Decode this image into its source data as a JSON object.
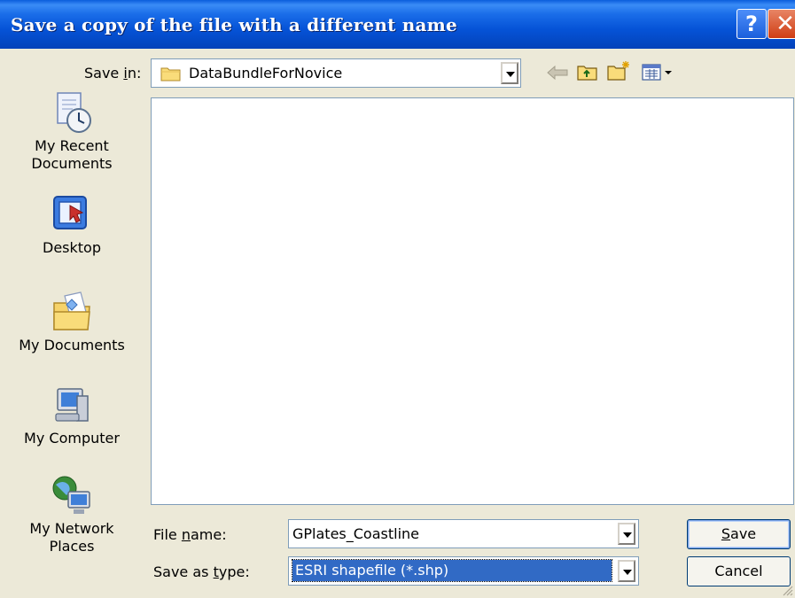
{
  "window": {
    "title": "Save a copy of the file with a different name",
    "help_label": "?",
    "close_label": "✕"
  },
  "save_in": {
    "label_prefix": "Save ",
    "label_mnemonic": "i",
    "label_suffix": "n:",
    "value": "DataBundleForNovice"
  },
  "places": [
    {
      "label_line1": "My Recent",
      "label_line2": "Documents",
      "icon": "recent-documents-icon"
    },
    {
      "label_line1": "Desktop",
      "label_line2": "",
      "icon": "desktop-icon"
    },
    {
      "label_line1": "My Documents",
      "label_line2": "",
      "icon": "my-documents-icon"
    },
    {
      "label_line1": "My Computer",
      "label_line2": "",
      "icon": "my-computer-icon"
    },
    {
      "label_line1": "My Network",
      "label_line2": "Places",
      "icon": "network-places-icon"
    }
  ],
  "file_name": {
    "label_prefix": "File ",
    "label_mnemonic": "n",
    "label_suffix": "ame:",
    "value": "GPlates_Coastline"
  },
  "save_as_type": {
    "label_prefix": "Save as ",
    "label_mnemonic": "t",
    "label_suffix": "ype:",
    "value": "ESRI shapefile (*.shp)"
  },
  "buttons": {
    "save_mnemonic": "S",
    "save_rest": "ave",
    "cancel": "Cancel"
  },
  "colors": {
    "titlebar": "#0553d7",
    "selection": "#316ac5",
    "dialog_bg": "#ece9d8"
  }
}
